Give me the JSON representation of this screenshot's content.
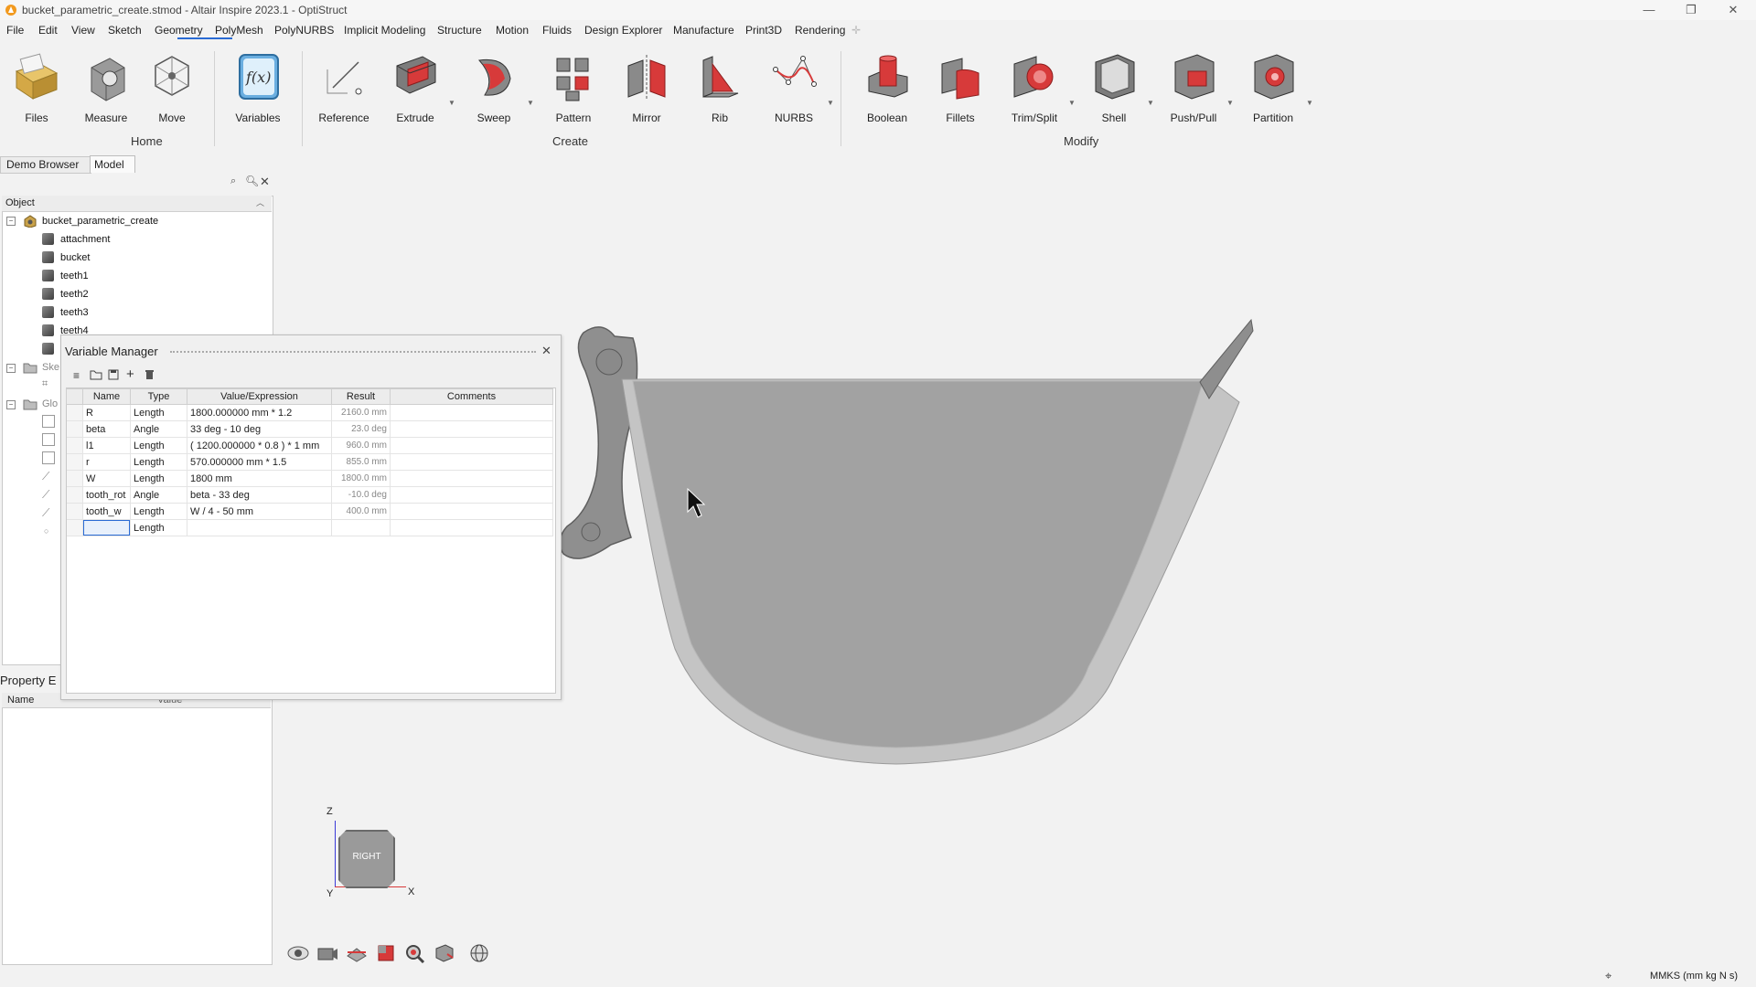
{
  "window": {
    "title": "bucket_parametric_create.stmod - Altair Inspire 2023.1 - OptiStruct",
    "minimize": "—",
    "restore": "❐",
    "close": "✕"
  },
  "menu": [
    "File",
    "Edit",
    "View",
    "Sketch",
    "Geometry",
    "PolyMesh",
    "PolyNURBS",
    "Implicit Modeling",
    "Structure",
    "Motion",
    "Fluids",
    "Design Explorer",
    "Manufacture",
    "Print3D",
    "Rendering"
  ],
  "ribbon": {
    "tools": [
      "Files",
      "Measure",
      "Move",
      "Variables",
      "Reference",
      "Extrude",
      "Sweep",
      "Pattern",
      "Mirror",
      "Rib",
      "NURBS",
      "Boolean",
      "Fillets",
      "Trim/Split",
      "Shell",
      "Push/Pull",
      "Partition"
    ],
    "groups": [
      "Home",
      "Create",
      "Modify"
    ]
  },
  "browser": {
    "tabs": [
      "Demo Browser",
      "Model"
    ],
    "object_header": "Object",
    "root": "bucket_parametric_create",
    "parts": [
      "attachment",
      "bucket",
      "teeth1",
      "teeth2",
      "teeth3",
      "teeth4"
    ],
    "partial_folders": [
      "Ske",
      "Glo"
    ]
  },
  "property_editor": {
    "title": "Property E",
    "col_name": "Name",
    "col_value": "Value"
  },
  "variable_manager": {
    "title": "Variable Manager",
    "columns": [
      "Name",
      "Type",
      "Value/Expression",
      "Result",
      "Comments"
    ],
    "rows": [
      {
        "name": "R",
        "type": "Length",
        "expr": "1800.000000 mm * 1.2",
        "result": "2160.0 mm",
        "comments": ""
      },
      {
        "name": "beta",
        "type": "Angle",
        "expr": "33 deg - 10 deg",
        "result": "23.0 deg",
        "comments": ""
      },
      {
        "name": "l1",
        "type": "Length",
        "expr": "( 1200.000000 * 0.8 ) * 1 mm",
        "result": "960.0 mm",
        "comments": ""
      },
      {
        "name": "r",
        "type": "Length",
        "expr": "570.000000 mm * 1.5",
        "result": "855.0 mm",
        "comments": ""
      },
      {
        "name": "W",
        "type": "Length",
        "expr": "1800 mm",
        "result": "1800.0 mm",
        "comments": ""
      },
      {
        "name": "tooth_rot",
        "type": "Angle",
        "expr": "beta - 33 deg",
        "result": "-10.0 deg",
        "comments": ""
      },
      {
        "name": "tooth_w",
        "type": "Length",
        "expr": "W / 4 - 50 mm",
        "result": "400.0 mm",
        "comments": ""
      },
      {
        "name": "",
        "type": "Length",
        "expr": "",
        "result": "",
        "comments": ""
      }
    ]
  },
  "view_cube": {
    "face": "RIGHT",
    "axis_z": "Z",
    "axis_y": "Y",
    "axis_x": "X"
  },
  "status": {
    "units": "MMKS (mm kg N s)"
  },
  "colors": {
    "accent": "#2a6bd4",
    "bucket_fill": "#9e9e9e",
    "bucket_rim": "#c4c4c4",
    "tool_red": "#d73a3a"
  }
}
